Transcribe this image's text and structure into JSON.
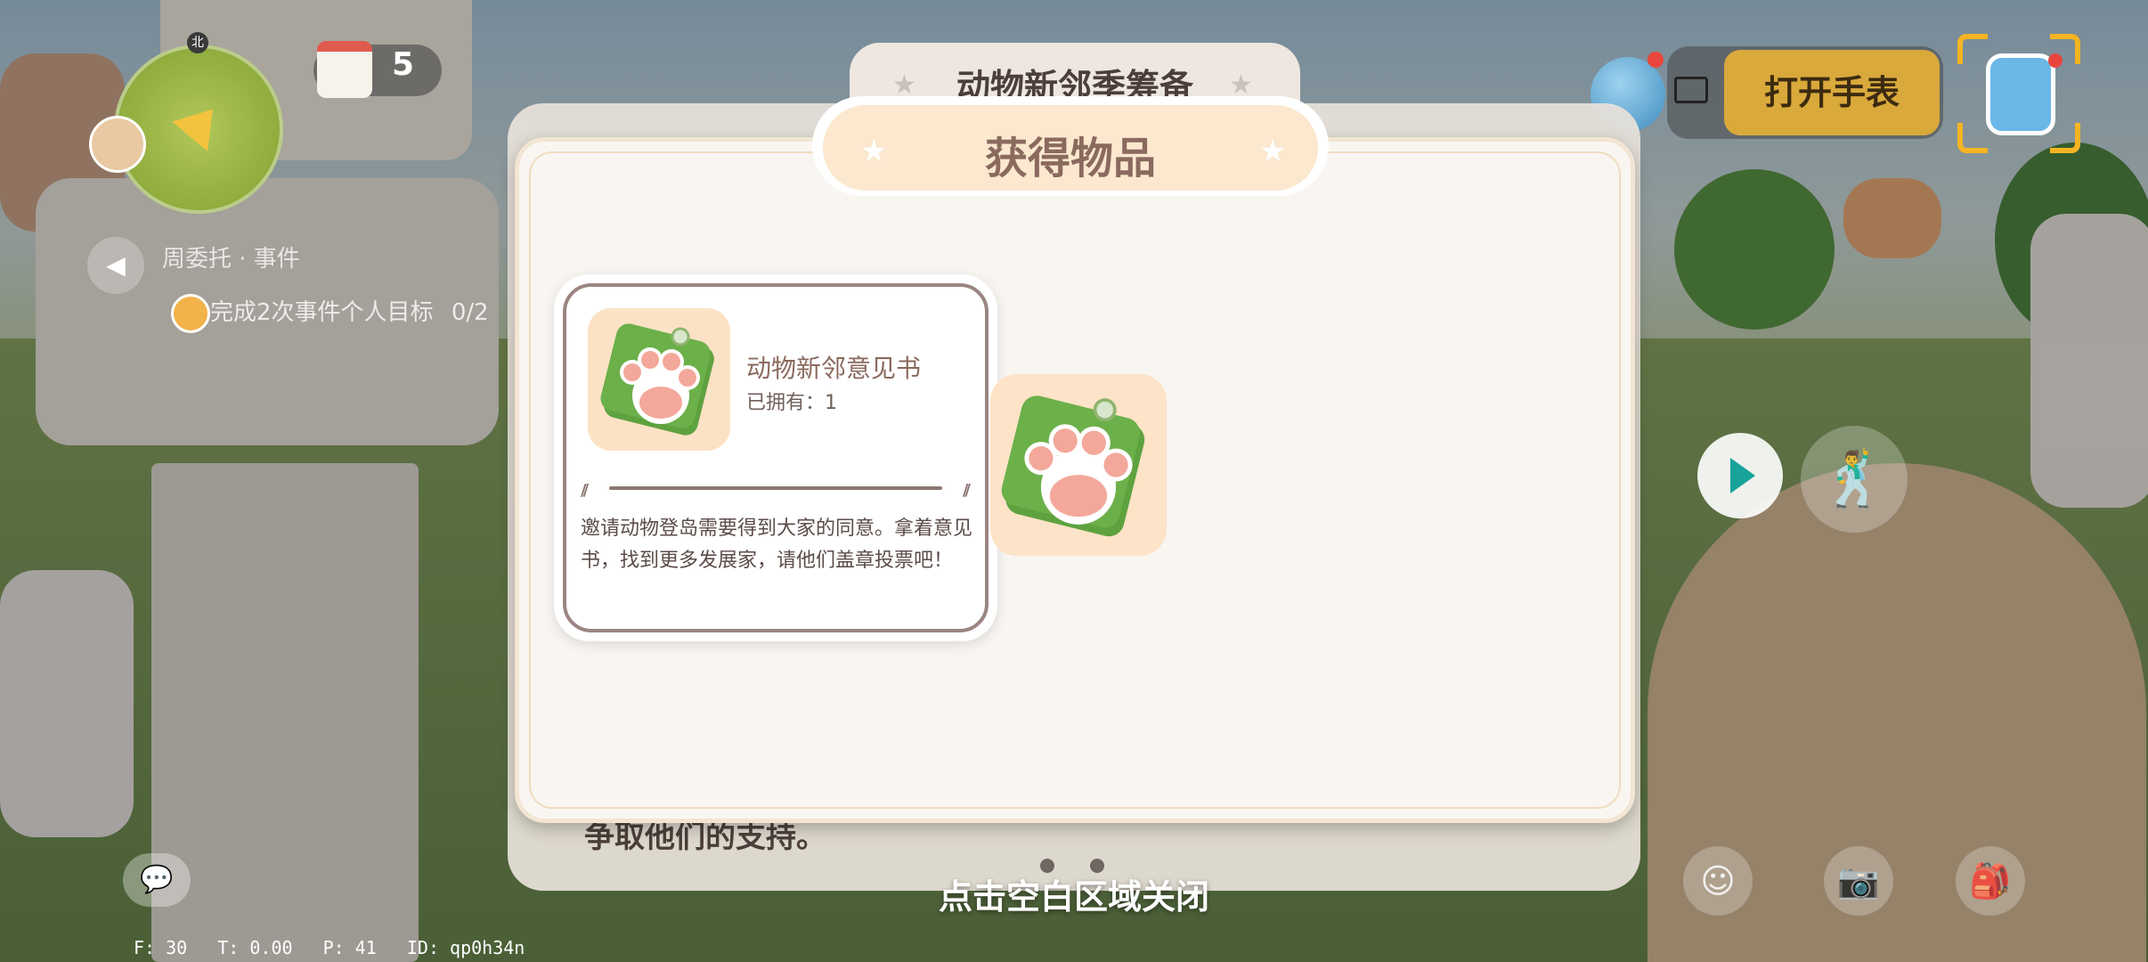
{
  "hud": {
    "minimap_north": "北",
    "calendar_count": "5",
    "open_watch_label": "打开手表",
    "quest_title": "周委托 · 事件",
    "quest_goal": "完成2次事件个人目标",
    "quest_progress": "0/2"
  },
  "background_dialog": {
    "title": "动物新邻季筹备",
    "body_text": "争取他们的支持。"
  },
  "reward_dialog": {
    "title": "获得物品",
    "item": {
      "name": "动物新邻意见书",
      "owned": "已拥有：1",
      "description": "邀请动物登岛需要得到大家的同意。拿着意见书，找到更多发展家，请他们盖章投票吧！",
      "icon": "paw-note-icon"
    },
    "close_hint": "点击空白区域关闭"
  },
  "debug": {
    "f": "F: 30",
    "t": "T: 0.00",
    "p": "P: 41",
    "id": "ID: qp0h34n"
  },
  "colors": {
    "dialog_bg": "#f9f6f2",
    "tab_bg": "#fbe8cf",
    "title_text": "#8a6a5e",
    "watch_button": "#d9a93b",
    "paw_green": "#6cb04a",
    "paw_pink": "#f4a89b"
  }
}
